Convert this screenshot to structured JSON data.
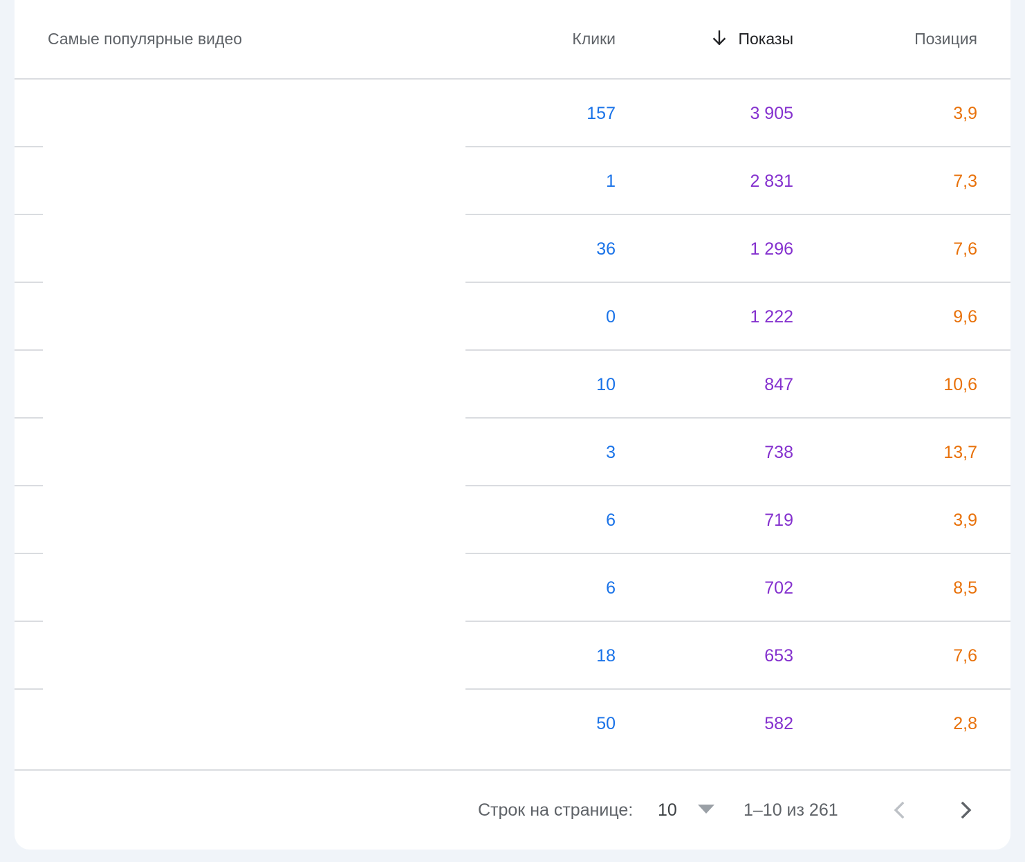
{
  "table": {
    "columns": {
      "title": "Самые популярные видео",
      "clicks": "Клики",
      "impressions": "Показы",
      "position": "Позиция"
    },
    "sorted_column": "impressions",
    "sort_direction": "descending",
    "rows": [
      {
        "clicks": "157",
        "impressions": "3 905",
        "position": "3,9"
      },
      {
        "clicks": "1",
        "impressions": "2 831",
        "position": "7,3"
      },
      {
        "clicks": "36",
        "impressions": "1 296",
        "position": "7,6"
      },
      {
        "clicks": "0",
        "impressions": "1 222",
        "position": "9,6"
      },
      {
        "clicks": "10",
        "impressions": "847",
        "position": "10,6"
      },
      {
        "clicks": "3",
        "impressions": "738",
        "position": "13,7"
      },
      {
        "clicks": "6",
        "impressions": "719",
        "position": "3,9"
      },
      {
        "clicks": "6",
        "impressions": "702",
        "position": "8,5"
      },
      {
        "clicks": "18",
        "impressions": "653",
        "position": "7,6"
      },
      {
        "clicks": "50",
        "impressions": "582",
        "position": "2,8"
      }
    ]
  },
  "pagination": {
    "rows_per_page_label": "Строк на странице:",
    "rows_per_page_value": "10",
    "range_text": "1–10 из 261",
    "prev_icon": "chevron-left-icon",
    "next_icon": "chevron-right-icon"
  },
  "colors": {
    "clicks": "#1a73e8",
    "impressions": "#8430ce",
    "position": "#e8710a",
    "divider": "#dadce0",
    "background": "#f0f4f9"
  }
}
